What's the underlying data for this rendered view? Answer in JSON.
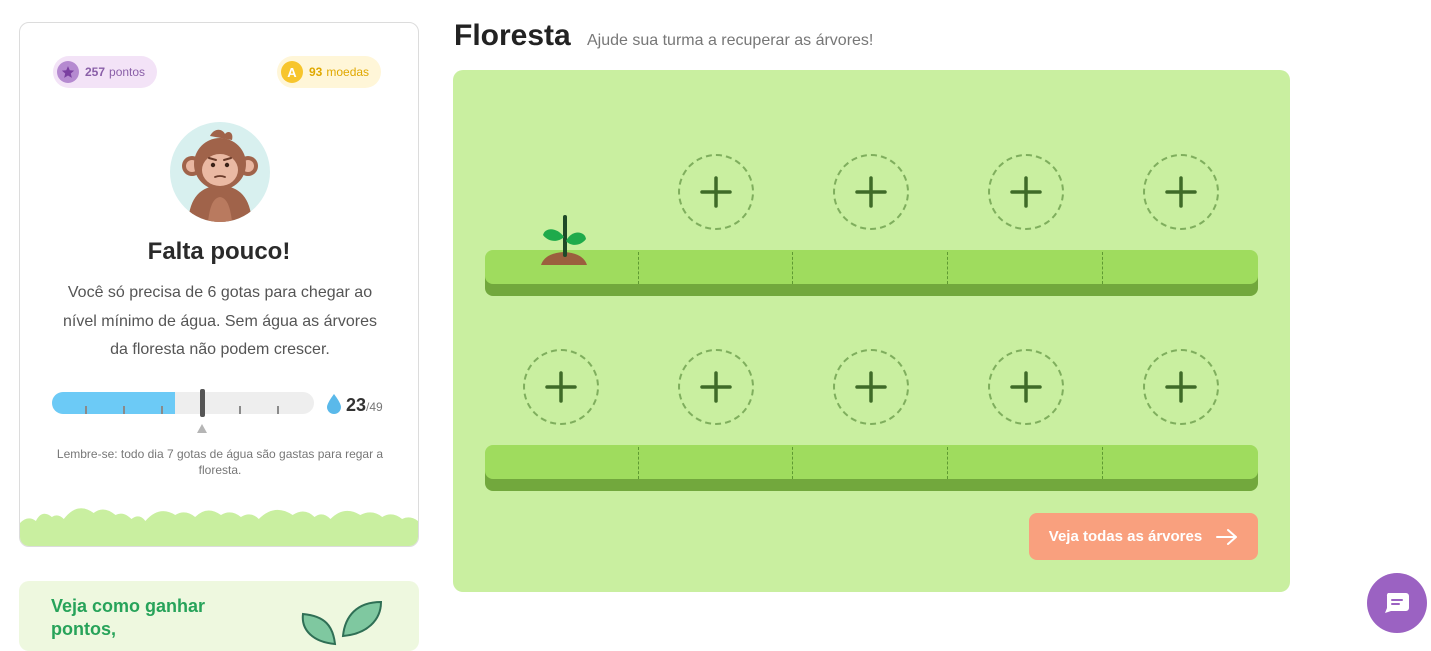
{
  "stats": {
    "points_value": "257",
    "points_label": "pontos",
    "coins_value": "93",
    "coins_label": "moedas",
    "coin_badge_letter": "A"
  },
  "status": {
    "headline": "Falta pouco!",
    "description": "Você só precisa de 6 gotas para chegar ao nível mínimo de água. Sem água as árvores da floresta não podem crescer.",
    "water_current": "23",
    "water_max": "/49",
    "water_fill_fraction": 0.47,
    "reminder": "Lembre-se: todo dia 7 gotas de água são gastas para regar a floresta."
  },
  "promo": {
    "text": "Veja como ganhar pontos,"
  },
  "forest": {
    "title": "Floresta",
    "subtitle": "Ajude sua turma a recuperar as árvores!",
    "cta_label": "Veja todas as árvores",
    "rows": [
      {
        "slots": [
          "sprout",
          "empty",
          "empty",
          "empty",
          "empty"
        ]
      },
      {
        "slots": [
          "empty",
          "empty",
          "empty",
          "empty",
          "empty"
        ]
      }
    ]
  },
  "colors": {
    "forest_bg": "#c9efa0",
    "shelf": "#9fdc5e",
    "cta": "#f9a07e",
    "water": "#6ccaf6",
    "points_accent": "#b58ad0",
    "coins_accent": "#f7c52c",
    "promo_text": "#27a35a",
    "chat_button": "#9b62c2"
  },
  "icons": {
    "points": "star-icon",
    "coins": "coin-icon",
    "water": "water-drop-icon",
    "slot": "plus-icon",
    "cta": "arrow-right-icon",
    "chat": "chat-icon"
  }
}
